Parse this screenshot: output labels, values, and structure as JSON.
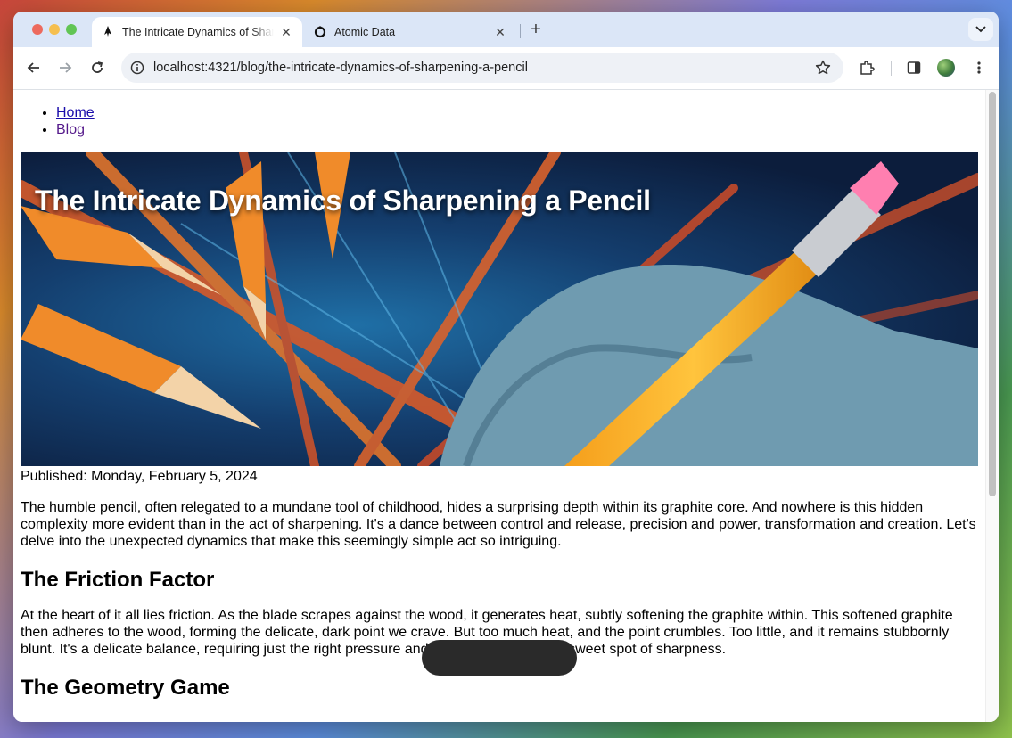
{
  "browser": {
    "tabs": [
      {
        "title": "The Intricate Dynamics of Sharpening a Pencil",
        "active": true
      },
      {
        "title": "Atomic Data",
        "active": false
      }
    ],
    "url": "localhost:4321/blog/the-intricate-dynamics-of-sharpening-a-pencil"
  },
  "nav": {
    "items": [
      {
        "label": "Home"
      },
      {
        "label": "Blog"
      }
    ]
  },
  "article": {
    "title": "The Intricate Dynamics of Sharpening a Pencil",
    "published": "Published: Monday, February 5, 2024",
    "intro": "The humble pencil, often relegated to a mundane tool of childhood, hides a surprising depth within its graphite core. And nowhere is this hidden complexity more evident than in the act of sharpening. It's a dance between control and release, precision and power, transformation and creation. Let's delve into the unexpected dynamics that make this seemingly simple act so intriguing.",
    "sections": [
      {
        "heading": "The Friction Factor",
        "body": "At the heart of it all lies friction. As the blade scrapes against the wood, it generates heat, subtly softening the graphite within. This softened graphite then adheres to the wood, forming the delicate, dark point we crave. But too much heat, and the point crumbles. Too little, and it remains stubbornly blunt. It's a delicate balance, requiring just the right pressure and angle to achieve that sweet spot of sharpness."
      },
      {
        "heading": "The Geometry Game",
        "body": ""
      }
    ]
  },
  "colors": {
    "link": "#1a0dab",
    "visited_link": "#551a8b",
    "tabbar": "#dbe6f7"
  }
}
